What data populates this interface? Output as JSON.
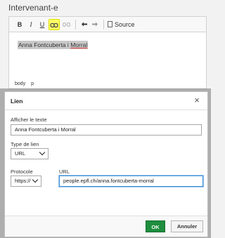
{
  "background": {
    "title": "Intervenant-e",
    "toolbar": {
      "bold": "B",
      "italic": "I",
      "underline": "U",
      "link_icon": "link-icon",
      "unlink_icon": "unlink-icon",
      "undo_icon": "undo-icon",
      "redo_icon": "redo-icon",
      "source_label": "Source"
    },
    "content_prefix": "Anna Fontcuberta i ",
    "content_underlined": "Morral",
    "path": [
      "body",
      "p"
    ]
  },
  "dialog": {
    "title": "Lien",
    "close_icon": "close-icon",
    "display_text_label": "Afficher le texte",
    "display_text_value": "Anna Fontcuberta i Morral",
    "link_type_label": "Type de lien",
    "link_type_value": "URL",
    "protocol_label": "Protocole",
    "protocol_value": "https://",
    "url_label": "URL",
    "url_value": "people.epfl.ch/anna.fontcuberta-morral",
    "ok_label": "OK",
    "cancel_label": "Annuler"
  },
  "colors": {
    "ok_button": "#1e8e3e",
    "focus_border": "#3a8fd6",
    "link_highlight": "#ffff66"
  }
}
